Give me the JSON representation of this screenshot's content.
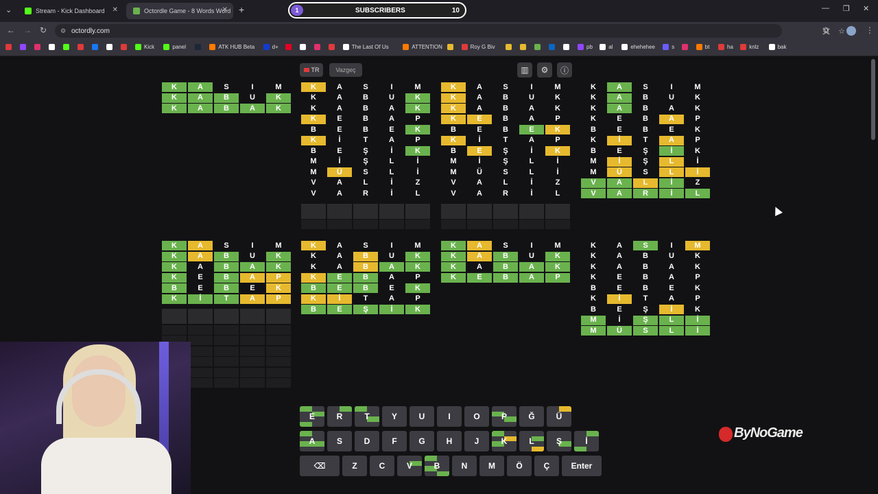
{
  "tabs": [
    {
      "label": "Stream - Kick Dashboard",
      "color": "#53fc18",
      "active": false
    },
    {
      "label": "Octordle Game - 8 Words Word",
      "color": "#6ab24e",
      "active": true
    }
  ],
  "subscribers": {
    "label": "SUBSCRIBERS",
    "current": "1",
    "goal": "10"
  },
  "address": "octordly.com",
  "bookmarks": [
    {
      "label": "",
      "color": "#e03a3a"
    },
    {
      "label": "",
      "color": "#9146ff"
    },
    {
      "label": "",
      "color": "#e1306c"
    },
    {
      "label": "",
      "color": "#ffffff"
    },
    {
      "label": "",
      "color": "#53fc18"
    },
    {
      "label": "",
      "color": "#e03a3a"
    },
    {
      "label": "",
      "color": "#1877f2"
    },
    {
      "label": "",
      "color": "#ffffff"
    },
    {
      "label": "",
      "color": "#e03a3a"
    },
    {
      "label": "Kick",
      "color": "#53fc18"
    },
    {
      "label": "panel",
      "color": "#53fc18"
    },
    {
      "label": "",
      "color": "#1b2838"
    },
    {
      "label": "ATK HUB Beta",
      "color": "#ff7a00"
    },
    {
      "label": "d+",
      "color": "#113ccf"
    },
    {
      "label": "",
      "color": "#e60023"
    },
    {
      "label": "",
      "color": "#ffffff"
    },
    {
      "label": "",
      "color": "#e1306c"
    },
    {
      "label": "",
      "color": "#e03a3a"
    },
    {
      "label": "The Last Of Us",
      "color": "#ffffff"
    },
    {
      "label": "ATTENTION",
      "color": "#ff7a00"
    },
    {
      "label": "",
      "color": "#e6b92e"
    },
    {
      "label": "Roy G Biv",
      "color": "#e03a3a"
    },
    {
      "label": "",
      "color": "#e6b92e"
    },
    {
      "label": "",
      "color": "#e6b92e"
    },
    {
      "label": "",
      "color": "#6ab24e"
    },
    {
      "label": "",
      "color": "#0a66c2"
    },
    {
      "label": "",
      "color": "#ffffff"
    },
    {
      "label": "pb",
      "color": "#9146ff"
    },
    {
      "label": "al",
      "color": "#ffffff"
    },
    {
      "label": "ehehehee",
      "color": "#ffffff"
    },
    {
      "label": "s",
      "color": "#6b5cff"
    },
    {
      "label": "",
      "color": "#e1306c"
    },
    {
      "label": "bt",
      "color": "#ff7a00"
    },
    {
      "label": "ha",
      "color": "#e03a3a"
    },
    {
      "label": "knlz",
      "color": "#e03a3a"
    },
    {
      "label": "bak",
      "color": "#ffffff"
    }
  ],
  "controls": {
    "lang": "TR",
    "giveup": "Vazgeç",
    "stats_icon": "bar-chart-icon",
    "settings_icon": "gear-icon",
    "info_icon": "info-icon"
  },
  "guesses": [
    "KASIM",
    "KABUK",
    "KABAK",
    "KEBAP",
    "BEBEK",
    "KİTAP",
    "BEŞİK",
    "MİŞLİ",
    "MÜSLİ",
    "VALİZ",
    "VARİL"
  ],
  "boards": [
    {
      "rows": [
        "GGNNN",
        "GGGNG",
        "GGGGG"
      ]
    },
    {
      "rows": [
        "YNNNN",
        "NNNNG",
        "NNNNG",
        "YNNNN",
        "NNNNG",
        "YNNNN",
        "NNNNG",
        "NNNNN",
        "NYNNN",
        "NNNNN",
        "NNNNN"
      ]
    },
    {
      "rows": [
        "YNNNN",
        "YNNNN",
        "YNNNN",
        "YYNNN",
        "NNNGY",
        "YNNNN",
        "NYNNY",
        "NNNNN",
        "NNNNN",
        "NNNNN",
        "NNNNN"
      ]
    },
    {
      "rows": [
        "NGNNN",
        "NGNNN",
        "NGNNN",
        "NNNYN",
        "NNNNN",
        "NYNYN",
        "NNNGN",
        "NYNYN",
        "NYNYY",
        "GGYGN",
        "GGGGG"
      ]
    },
    {
      "rows": [
        "GYNNN",
        "GYGNG",
        "GNGGG",
        "GNGYY",
        "GNGNY",
        "GGGYY"
      ]
    },
    {
      "rows": [
        "YNNNN",
        "NNYNG",
        "NNYGG",
        "YGGNN",
        "GGGNG",
        "YYNNN",
        "GGGGG"
      ]
    },
    {
      "rows": [
        "GYNNN",
        "GYGNG",
        "GNGGG",
        "GGGGG"
      ]
    },
    {
      "rows": [
        "NNGNY",
        "NNNNN",
        "NNNNN",
        "NNNNN",
        "NNNNN",
        "NYNNN",
        "NNNYN",
        "GNGGG",
        "GGGGG"
      ]
    }
  ],
  "keyboard": {
    "rows": [
      [
        "E",
        "R",
        "T",
        "Y",
        "U",
        "I",
        "O",
        "P",
        "Ğ",
        "Ü"
      ],
      [
        "A",
        "S",
        "D",
        "F",
        "G",
        "H",
        "J",
        "K",
        "L",
        "Ş",
        "İ"
      ],
      [
        "backspace",
        "Z",
        "C",
        "V",
        "B",
        "N",
        "M",
        "Ö",
        "Ç",
        "Enter"
      ]
    ],
    "backspace_icon": "backspace-icon"
  },
  "watermark": "ByNoGame",
  "colors": {
    "green": "#6ab24e",
    "yellow": "#e6b92e",
    "key": "#3c3c42",
    "bg": "#121214"
  }
}
